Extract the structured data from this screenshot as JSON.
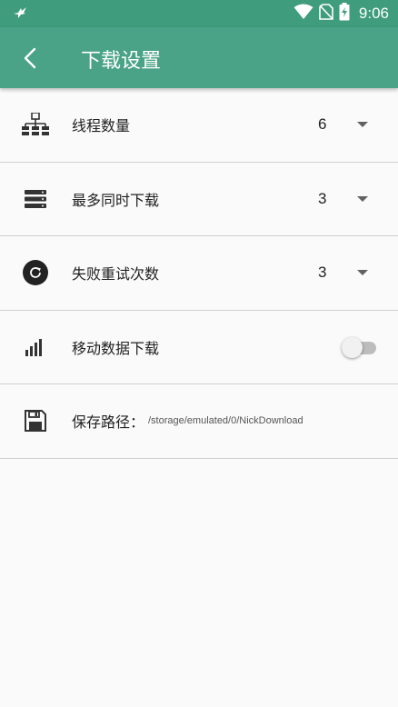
{
  "status_bar": {
    "time": "9:06",
    "icons": [
      "bird-icon",
      "wifi-icon",
      "no-sim-icon",
      "battery-charging-icon"
    ]
  },
  "app_bar": {
    "title": "下载设置",
    "back_icon": "back-arrow-icon",
    "color": "#4aa386"
  },
  "settings": {
    "thread_count": {
      "label": "线程数量",
      "value": "6",
      "icon": "network-tree-icon"
    },
    "max_simultaneous": {
      "label": "最多同时下载",
      "value": "3",
      "icon": "server-stack-icon"
    },
    "retry_count": {
      "label": "失败重试次数",
      "value": "3",
      "icon": "refresh-circle-icon"
    },
    "mobile_data": {
      "label": "移动数据下载",
      "enabled": false,
      "icon": "signal-bars-icon"
    },
    "save_path": {
      "label": "保存路径：",
      "value": "/storage/emulated/0/NickDownload",
      "icon": "floppy-disk-icon"
    }
  }
}
